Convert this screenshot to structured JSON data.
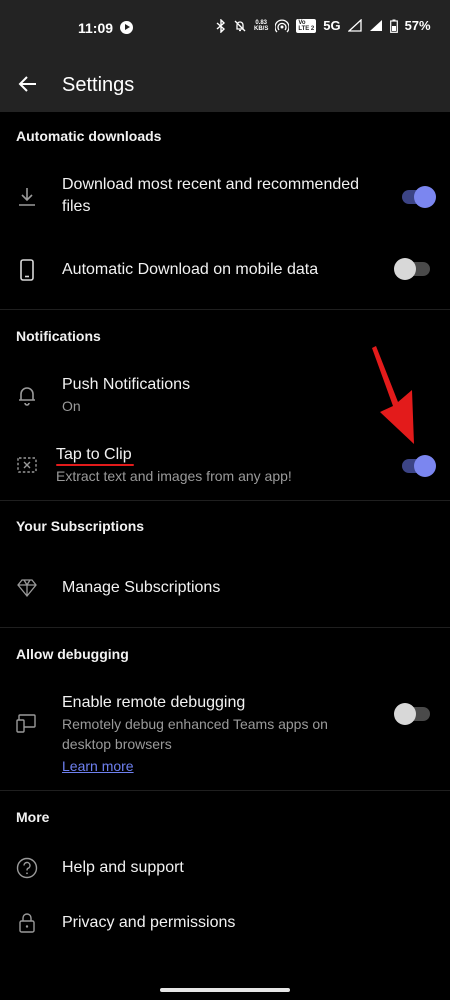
{
  "status_bar": {
    "time": "11:09",
    "speed_value": "0.83",
    "speed_unit": "KB/S",
    "volte_top": "Vo",
    "volte_bottom": "LTE 2",
    "network": "5G",
    "battery": "57%"
  },
  "app_bar": {
    "title": "Settings"
  },
  "sections": {
    "automatic_downloads": {
      "title": "Automatic downloads",
      "recent_line1": "Download most recent and recommended",
      "recent_line2": "files",
      "recent_on": true,
      "mobile_data": "Automatic Download on mobile data",
      "mobile_data_on": false
    },
    "notifications": {
      "title": "Notifications",
      "push_title": "Push Notifications",
      "push_sub": "On",
      "clip_title": "Tap to Clip",
      "clip_sub": "Extract text and images from any app!",
      "clip_on": true
    },
    "subscriptions": {
      "title": "Your Subscriptions",
      "manage": "Manage Subscriptions"
    },
    "debugging": {
      "title": "Allow debugging",
      "remote_title": "Enable remote debugging",
      "remote_sub_line1": "Remotely debug enhanced Teams apps on",
      "remote_sub_line2": "desktop browsers",
      "learn_more": "Learn more",
      "remote_on": false
    },
    "more": {
      "title": "More",
      "help": "Help and support",
      "privacy": "Privacy and permissions"
    }
  },
  "colors": {
    "toggle_on_knob": "#7b86f0",
    "toggle_on_track": "#3c4486",
    "annotation_red": "#e31b1b",
    "link": "#6e80f0"
  },
  "icons": [
    "play-icon",
    "bluetooth-icon",
    "mute-icon",
    "hotspot-icon",
    "signal-icon",
    "battery-icon",
    "back-arrow-icon",
    "download-icon",
    "phone-icon",
    "bell-icon",
    "clip-icon",
    "diamond-icon",
    "devices-icon",
    "help-icon",
    "lock-icon"
  ]
}
